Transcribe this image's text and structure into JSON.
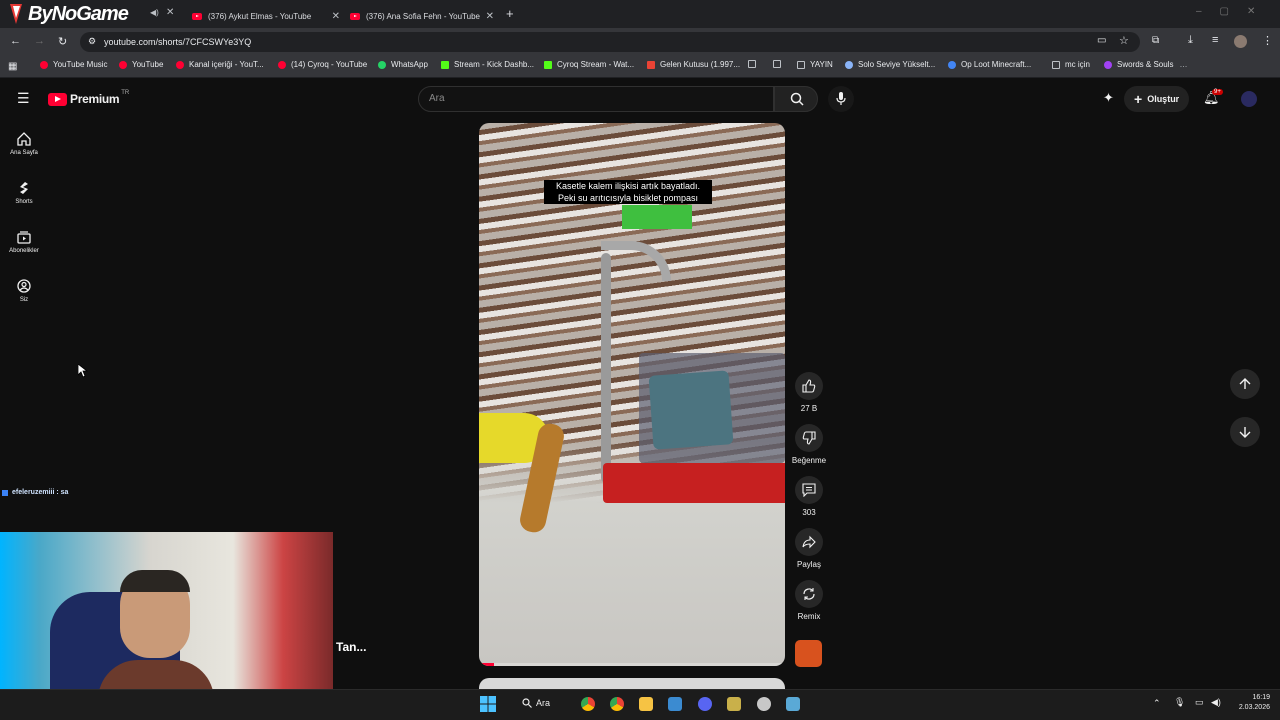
{
  "overlay": {
    "logo_text": "ByNoGame"
  },
  "tabs": [
    {
      "label": "(376) Aykut Elmas - YouTube"
    },
    {
      "label": "(376) Ana Sofia Fehn - YouTube"
    }
  ],
  "omnibox": {
    "url": "youtube.com/shorts/7CFCSWYe3YQ"
  },
  "bookmarks": [
    {
      "label": "YouTube Music",
      "color": "#ff0033"
    },
    {
      "label": "YouTube",
      "color": "#ff0033"
    },
    {
      "label": "Kanal içeriği - YouT...",
      "color": "#ff0033"
    },
    {
      "label": "(14) Cyroq - YouTube",
      "color": "#ff0033"
    },
    {
      "label": "WhatsApp",
      "color": "#25d366"
    },
    {
      "label": "Stream - Kick Dashb...",
      "color": "#53fc18"
    },
    {
      "label": "Cyroq Stream - Wat...",
      "color": "#53fc18"
    },
    {
      "label": "Gelen Kutusu (1.997...",
      "color": "#ea4335"
    },
    {
      "label": "YAYIN",
      "color": "#bdc1c6"
    },
    {
      "label": "Solo Seviye Yükselt...",
      "color": "#8ab4f8"
    },
    {
      "label": "Op Loot Minecraft...",
      "color": "#4285f4"
    },
    {
      "label": "mc için",
      "color": "#bdc1c6"
    },
    {
      "label": "Swords & Souls",
      "color": "#a142f4"
    }
  ],
  "youtube": {
    "brand": "Premium",
    "region": "TR",
    "search_placeholder": "Ara",
    "create_label": "Oluştur",
    "notif_badge": "9+",
    "nav": [
      {
        "label": "Ana Sayfa"
      },
      {
        "label": "Shorts"
      },
      {
        "label": "Abonelikler"
      },
      {
        "label": "Siz"
      }
    ]
  },
  "short": {
    "caption_line1": "Kasetle kalem ilişkisi artık bayatladı.",
    "caption_line2": "Peki su arıtıcısıyla bisiklet pompası",
    "likes": "27 B",
    "dislike_label": "Beğenme",
    "comments": "303",
    "share_label": "Paylaş",
    "remix_label": "Remix"
  },
  "chat": {
    "message": "efeleruzemiii : sa"
  },
  "stream": {
    "overlay_text": "Tan..."
  },
  "taskbar": {
    "search_label": "Ara",
    "time": "16:19",
    "date": "2.03.2026"
  }
}
